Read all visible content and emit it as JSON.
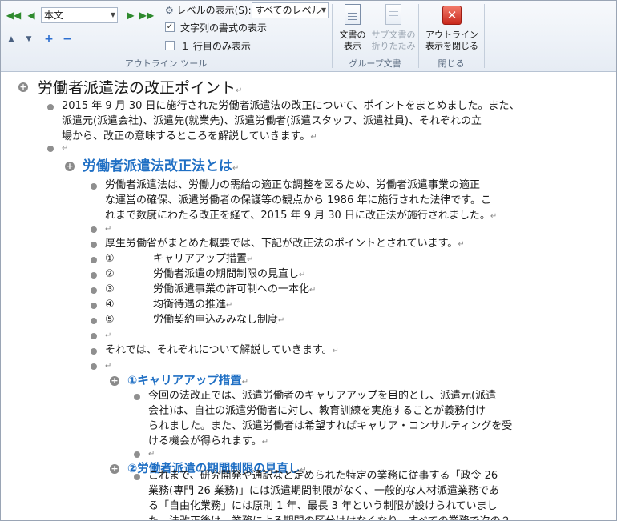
{
  "ribbon": {
    "level_combo": "本文",
    "show_level_label": "レベルの表示(S):",
    "show_level_value": "すべてのレベル",
    "show_formatting_label": "文字列の書式の表示",
    "first_line_only_label": "１ 行目のみ表示",
    "outline_tools_label": "アウトライン ツール",
    "show_doc_label": "文書の\n表示",
    "collapse_sub_label": "サブ文書の\n折りたたみ",
    "group_doc_label": "グループ文書",
    "close_outline_label": "アウトライン\n表示を閉じる",
    "close_group_label": "閉じる"
  },
  "doc": {
    "h1": "労働者派遣法の改正ポイント",
    "intro": [
      "2015 年 9 月 30 日に施行された労働者派遣法の改正について、ポイントをまとめました。また、",
      "派遣元(派遣会社)、派遣先(就業先)、派遣労働者(派遣スタッフ、派遣社員)、それぞれの立",
      "場から、改正の意味するところを解説していきます。"
    ],
    "h2": "労働者派遣法改正法とは",
    "p1": [
      "労働者派遣法は、労働力の需給の適正な調整を図るため、労働者派遣事業の適正",
      "な運営の確保、派遣労働者の保護等の観点から 1986 年に施行された法律です。こ",
      "れまで数度にわたる改正を経て、2015 年 9 月 30 日に改正法が施行されました。"
    ],
    "p2": "厚生労働省がまとめた概要では、下記が改正法のポイントとされています。",
    "points": [
      {
        "num": "①",
        "text": "キャリアアップ措置"
      },
      {
        "num": "②",
        "text": "労働者派遣の期間制限の見直し"
      },
      {
        "num": "③",
        "text": "労働派遣事業の許可制への一本化"
      },
      {
        "num": "④",
        "text": "均衡待遇の推進"
      },
      {
        "num": "⑤",
        "text": "労働契約申込みみなし制度"
      }
    ],
    "p3": "それでは、それぞれについて解説していきます。",
    "h3a": "①キャリアアップ措置",
    "p4": [
      "今回の法改正では、派遣労働者のキャリアアップを目的とし、派遣元(派遣",
      "会社)は、自社の派遣労働者に対し、教育訓練を実施することが義務付け",
      "られました。また、派遣労働者は希望すればキャリア・コンサルティングを受",
      "ける機会が得られます。"
    ],
    "h3b": "②労働者派遣の期間制限の見直し",
    "p5": [
      "これまで、研究開発や通訳など定められた特定の業務に従事する「政令 26",
      "業務(専門 26 業務)」には派遣期間制限がなく、一般的な人材派遣業務であ",
      "る「自由化業務」には原則 1 年、最長 3 年という制限が設けられていまし",
      "た。法改正後は、業務による期間の区分けはなくなり、すべての業務で次の２"
    ]
  }
}
